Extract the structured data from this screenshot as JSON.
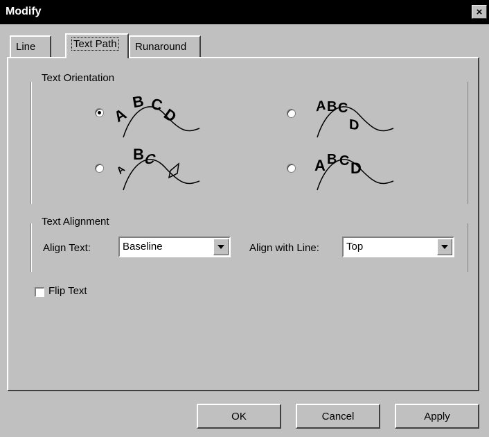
{
  "window": {
    "title": "Modify",
    "close_glyph": "×",
    "close_icon": "close-icon"
  },
  "tabs": [
    {
      "label": "Line",
      "active": false
    },
    {
      "label": "Text Path",
      "active": true
    },
    {
      "label": "Runaround",
      "active": false
    }
  ],
  "orientation": {
    "label": "Text Orientation",
    "options": [
      {
        "sample": "ABCD",
        "style": "rotated along curve",
        "selected": true
      },
      {
        "sample": "ABCD",
        "style": "skewed along curve",
        "selected": false
      },
      {
        "sample": "ABCD",
        "style": "3D ribbon along curve",
        "selected": false
      },
      {
        "sample": "ABCD",
        "style": "stair-stepped along curve",
        "selected": false
      }
    ]
  },
  "alignment": {
    "label": "Text Alignment",
    "align_text_label": "Align Text:",
    "align_text_value": "Baseline",
    "align_line_label": "Align with Line:",
    "align_line_value": "Top"
  },
  "flip_text": {
    "label": "Flip Text",
    "checked": false
  },
  "buttons": {
    "ok": "OK",
    "cancel": "Cancel",
    "apply": "Apply"
  }
}
